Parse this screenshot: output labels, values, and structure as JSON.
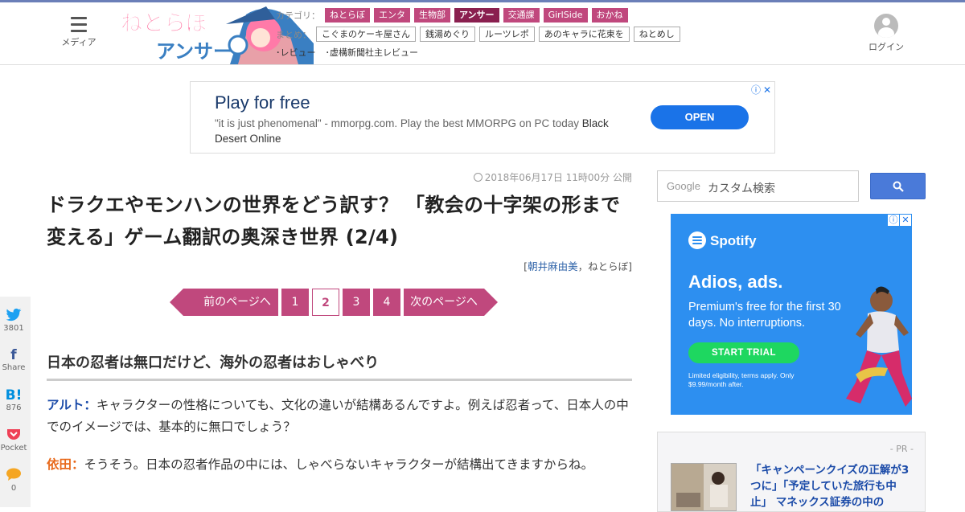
{
  "header": {
    "menu_label": "メディア",
    "categories_label": "カテゴリ：",
    "categories": [
      "ねとらぼ",
      "エンタ",
      "生物部",
      "アンサー",
      "交通課",
      "GirlSide",
      "おかね"
    ],
    "matome_label": "まとめ：",
    "matome": [
      "こぐまのケーキ屋さん",
      "銭湯めぐり",
      "ルーツレポ",
      "あのキャラに花束を",
      "ねとめし"
    ],
    "reviews": [
      "･レビュー",
      "･虚構新聞社主レビュー"
    ],
    "login_label": "ログイン",
    "logo_text": "ねとらぼアンサー"
  },
  "top_ad": {
    "title": "Play for free",
    "desc_main": "\"it is just phenomenal\" - mmorpg.com. Play the best MMORPG on PC today ",
    "desc_brand": "Black Desert Online",
    "cta": "OPEN",
    "info_icon": "ⓘ",
    "close_icon": "✕"
  },
  "article": {
    "date": "2018年06月17日 11時00分 公開",
    "title": "ドラクエやモンハンの世界をどう訳す？ 「教会の十字架の形まで変える」ゲーム翻訳の奥深き世界 (2/4)",
    "byline_open": "[",
    "author": "朝井麻由美",
    "byline_sep": "，",
    "publisher": "ねとらぼ",
    "byline_close": "]",
    "pager": {
      "prev": "前のページへ",
      "pages": [
        "1",
        "2",
        "3",
        "4"
      ],
      "current": "2",
      "next": "次のページへ"
    },
    "section_heading": "日本の忍者は無口だけど、海外の忍者はおしゃべり",
    "paragraphs": [
      {
        "speaker": "アルト：",
        "text": "キャラクターの性格についても、文化の違いが結構あるんですよ。例えば忍者って、日本人の中でのイメージでは、基本的に無口でしょう？"
      },
      {
        "speaker": "依田：",
        "text": "そうそう。日本の忍者作品の中には、しゃべらないキャラクターが結構出てきますからね。"
      }
    ]
  },
  "share": [
    {
      "icon": "twitter-icon",
      "count": "3801"
    },
    {
      "icon": "facebook-icon",
      "count": "Share"
    },
    {
      "icon": "hatena-icon",
      "glyph": "B!",
      "count": "876"
    },
    {
      "icon": "pocket-icon",
      "count": "Pocket"
    },
    {
      "icon": "comment-icon",
      "count": "0"
    }
  ],
  "sidebar": {
    "search_brand": "Google",
    "search_placeholder": "カスタム検索",
    "spotify_ad": {
      "brand": "Spotify",
      "head": "Adios, ads.",
      "sub": "Premium's free for the first 30 days. No interruptions.",
      "cta": "START TRIAL",
      "fine": "Limited eligibility, terms apply. Only $9.99/month after."
    },
    "pr": {
      "label": "- PR -",
      "title": "「キャンペーンクイズの正解が3つに」「予定していた旅行も中止」 マネックス証券の中の"
    }
  },
  "colors": {
    "accent": "#c0487d",
    "accent_dark": "#8a1f4f",
    "link": "#3366aa",
    "speaker_a": "#1a4aa8",
    "speaker_b": "#e8691b",
    "top_bar": "#6b7fb8"
  }
}
